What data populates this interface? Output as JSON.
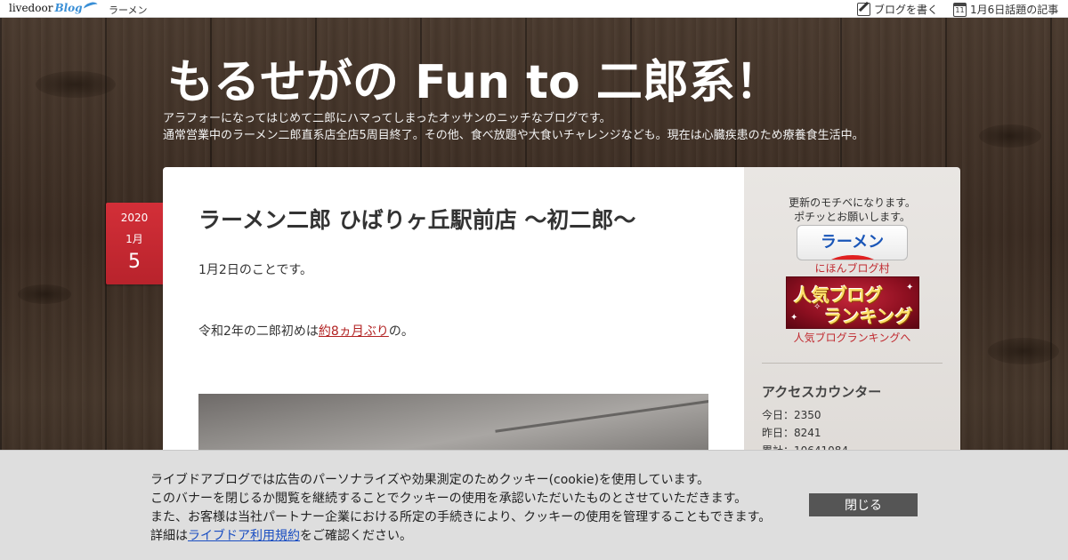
{
  "topbar": {
    "logo_main": "livedoor",
    "logo_blog": "Blog",
    "category": "ラーメン",
    "write_blog": "ブログを書く",
    "calendar_day": "11",
    "topic_link": "1月6日話題の記事"
  },
  "header": {
    "title": "もるせがの Fun to 二郎系！",
    "description_line1": "アラフォーになってはじめて二郎にハマってしまったオッサンのニッチなブログです。",
    "description_line2": "通常営業中のラーメン二郎直系店全店5周目終了。その他、食べ放題や大食いチャレンジなども。現在は心臓疾患のため療養食生活中。"
  },
  "post": {
    "date": {
      "year": "2020",
      "month": "1月",
      "day": "5"
    },
    "title": "ラーメン二郎 ひばりヶ丘駅前店 〜初二郎〜",
    "para1": "1月2日のことです。",
    "para2_before": "令和2年の二郎初めは",
    "para2_link": "約8ヵ月ぶり",
    "para2_after": "の。"
  },
  "sidebar": {
    "note_line1": "更新のモチベになります。",
    "note_line2": "ポチッとお願いします。",
    "ramen_button": "ラーメン",
    "nihon_blog_link": "にほんブログ村",
    "ranking_banner_line1": "人気ブログ",
    "ranking_banner_line2": "ランキング",
    "ranking_link": "人気ブログランキングへ",
    "counter_title": "アクセスカウンター",
    "counter_today": "今日：2350",
    "counter_yesterday": "昨日：8241",
    "counter_total": "累計：10641084"
  },
  "cookie_banner": {
    "line1": "ライブドアブログでは広告のパーソナライズや効果測定のためクッキー(cookie)を使用しています。",
    "line2": "このバナーを閉じるか閲覧を継続することでクッキーの使用を承認いただいたものとさせていただきます。",
    "line3": "また、お客様は当社パートナー企業における所定の手続きにより、クッキーの使用を管理することもできます。",
    "line4_before": "詳細は",
    "line4_link": "ライブドア利用規約",
    "line4_after": "をご確認ください。",
    "close_label": "閉じる"
  },
  "colors": {
    "date_badge": "#c8282f",
    "link_red": "#b22222",
    "cookie_bg": "#dedede",
    "close_button": "#555555"
  }
}
